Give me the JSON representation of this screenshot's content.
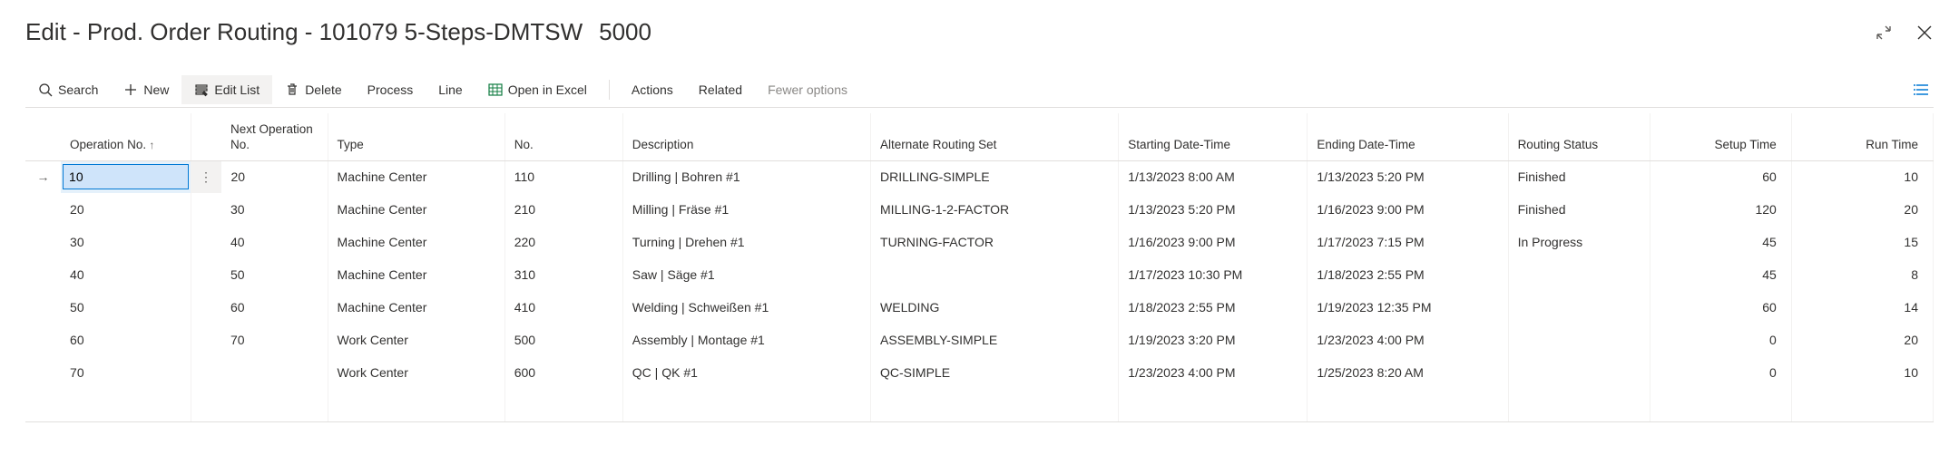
{
  "header": {
    "title_main": "Edit - Prod. Order Routing - 101079 5-Steps-DMTSW",
    "title_sub": "5000"
  },
  "toolbar": {
    "search": "Search",
    "new": "New",
    "edit_list": "Edit List",
    "delete": "Delete",
    "process": "Process",
    "line": "Line",
    "open_excel": "Open in Excel",
    "actions": "Actions",
    "related": "Related",
    "fewer": "Fewer options"
  },
  "columns": {
    "operation_no": "Operation No.",
    "next_op": "Next Operation No.",
    "type": "Type",
    "no": "No.",
    "description": "Description",
    "alt_routing": "Alternate Routing Set",
    "start": "Starting Date-Time",
    "end": "Ending Date-Time",
    "status": "Routing Status",
    "setup": "Setup Time",
    "run": "Run Time"
  },
  "selected_value": "10",
  "rows": [
    {
      "op": "10",
      "next": "20",
      "type": "Machine Center",
      "no": "110",
      "desc": "Drilling | Bohren #1",
      "alt": "DRILLING-SIMPLE",
      "start": "1/13/2023 8:00 AM",
      "end": "1/13/2023 5:20 PM",
      "status": "Finished",
      "setup": "60",
      "run": "10"
    },
    {
      "op": "20",
      "next": "30",
      "type": "Machine Center",
      "no": "210",
      "desc": "Milling | Fräse #1",
      "alt": "MILLING-1-2-FACTOR",
      "start": "1/13/2023 5:20 PM",
      "end": "1/16/2023 9:00 PM",
      "status": "Finished",
      "setup": "120",
      "run": "20"
    },
    {
      "op": "30",
      "next": "40",
      "type": "Machine Center",
      "no": "220",
      "desc": "Turning | Drehen #1",
      "alt": "TURNING-FACTOR",
      "start": "1/16/2023 9:00 PM",
      "end": "1/17/2023 7:15 PM",
      "status": "In Progress",
      "setup": "45",
      "run": "15"
    },
    {
      "op": "40",
      "next": "50",
      "type": "Machine Center",
      "no": "310",
      "desc": "Saw | Säge #1",
      "alt": "",
      "start": "1/17/2023 10:30 PM",
      "end": "1/18/2023 2:55 PM",
      "status": "",
      "setup": "45",
      "run": "8"
    },
    {
      "op": "50",
      "next": "60",
      "type": "Machine Center",
      "no": "410",
      "desc": "Welding | Schweißen #1",
      "alt": "WELDING",
      "start": "1/18/2023 2:55 PM",
      "end": "1/19/2023 12:35 PM",
      "status": "",
      "setup": "60",
      "run": "14"
    },
    {
      "op": "60",
      "next": "70",
      "type": "Work Center",
      "no": "500",
      "desc": "Assembly | Montage #1",
      "alt": "ASSEMBLY-SIMPLE",
      "start": "1/19/2023 3:20 PM",
      "end": "1/23/2023 4:00 PM",
      "status": "",
      "setup": "0",
      "run": "20"
    },
    {
      "op": "70",
      "next": "",
      "type": "Work Center",
      "no": "600",
      "desc": "QC | QK #1",
      "alt": "QC-SIMPLE",
      "start": "1/23/2023 4:00 PM",
      "end": "1/25/2023 8:20 AM",
      "status": "",
      "setup": "0",
      "run": "10"
    }
  ]
}
